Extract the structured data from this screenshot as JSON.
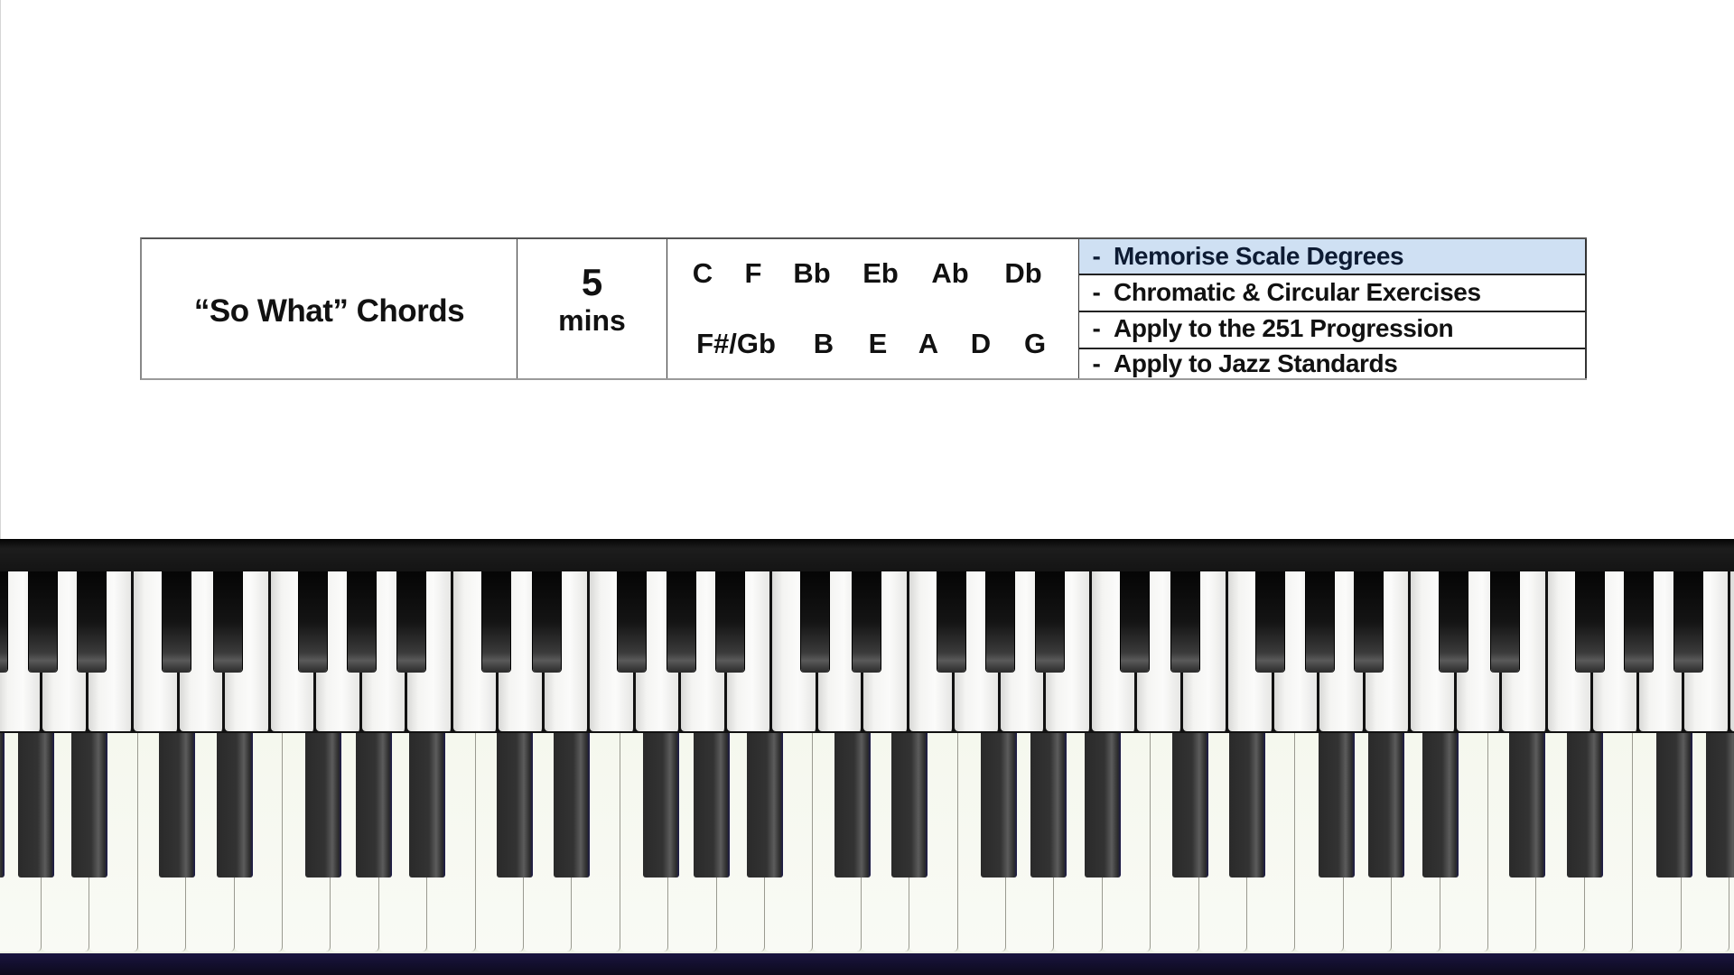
{
  "lesson": {
    "title": "“So What” Chords",
    "duration": {
      "value": "5",
      "unit": "mins"
    },
    "keys_row1": [
      "C",
      "F",
      "Bb",
      "Eb",
      "Ab",
      "Db"
    ],
    "keys_row2": [
      "F#/Gb",
      "B",
      "E",
      "A",
      "D",
      "G"
    ],
    "tasks": [
      {
        "dash": "-",
        "label": "Memorise Scale Degrees",
        "active": true
      },
      {
        "dash": "-",
        "label": "Chromatic & Circular Exercises",
        "active": false
      },
      {
        "dash": "-",
        "label": "Apply to the 251 Progression",
        "active": false
      },
      {
        "dash": "-",
        "label": "Apply to Jazz Standards",
        "active": false
      }
    ],
    "highlight_color": "#cfe0f3"
  },
  "keyboards": {
    "upper": {
      "first_white_key": "G"
    },
    "lower": {
      "first_white_key": "G"
    }
  }
}
